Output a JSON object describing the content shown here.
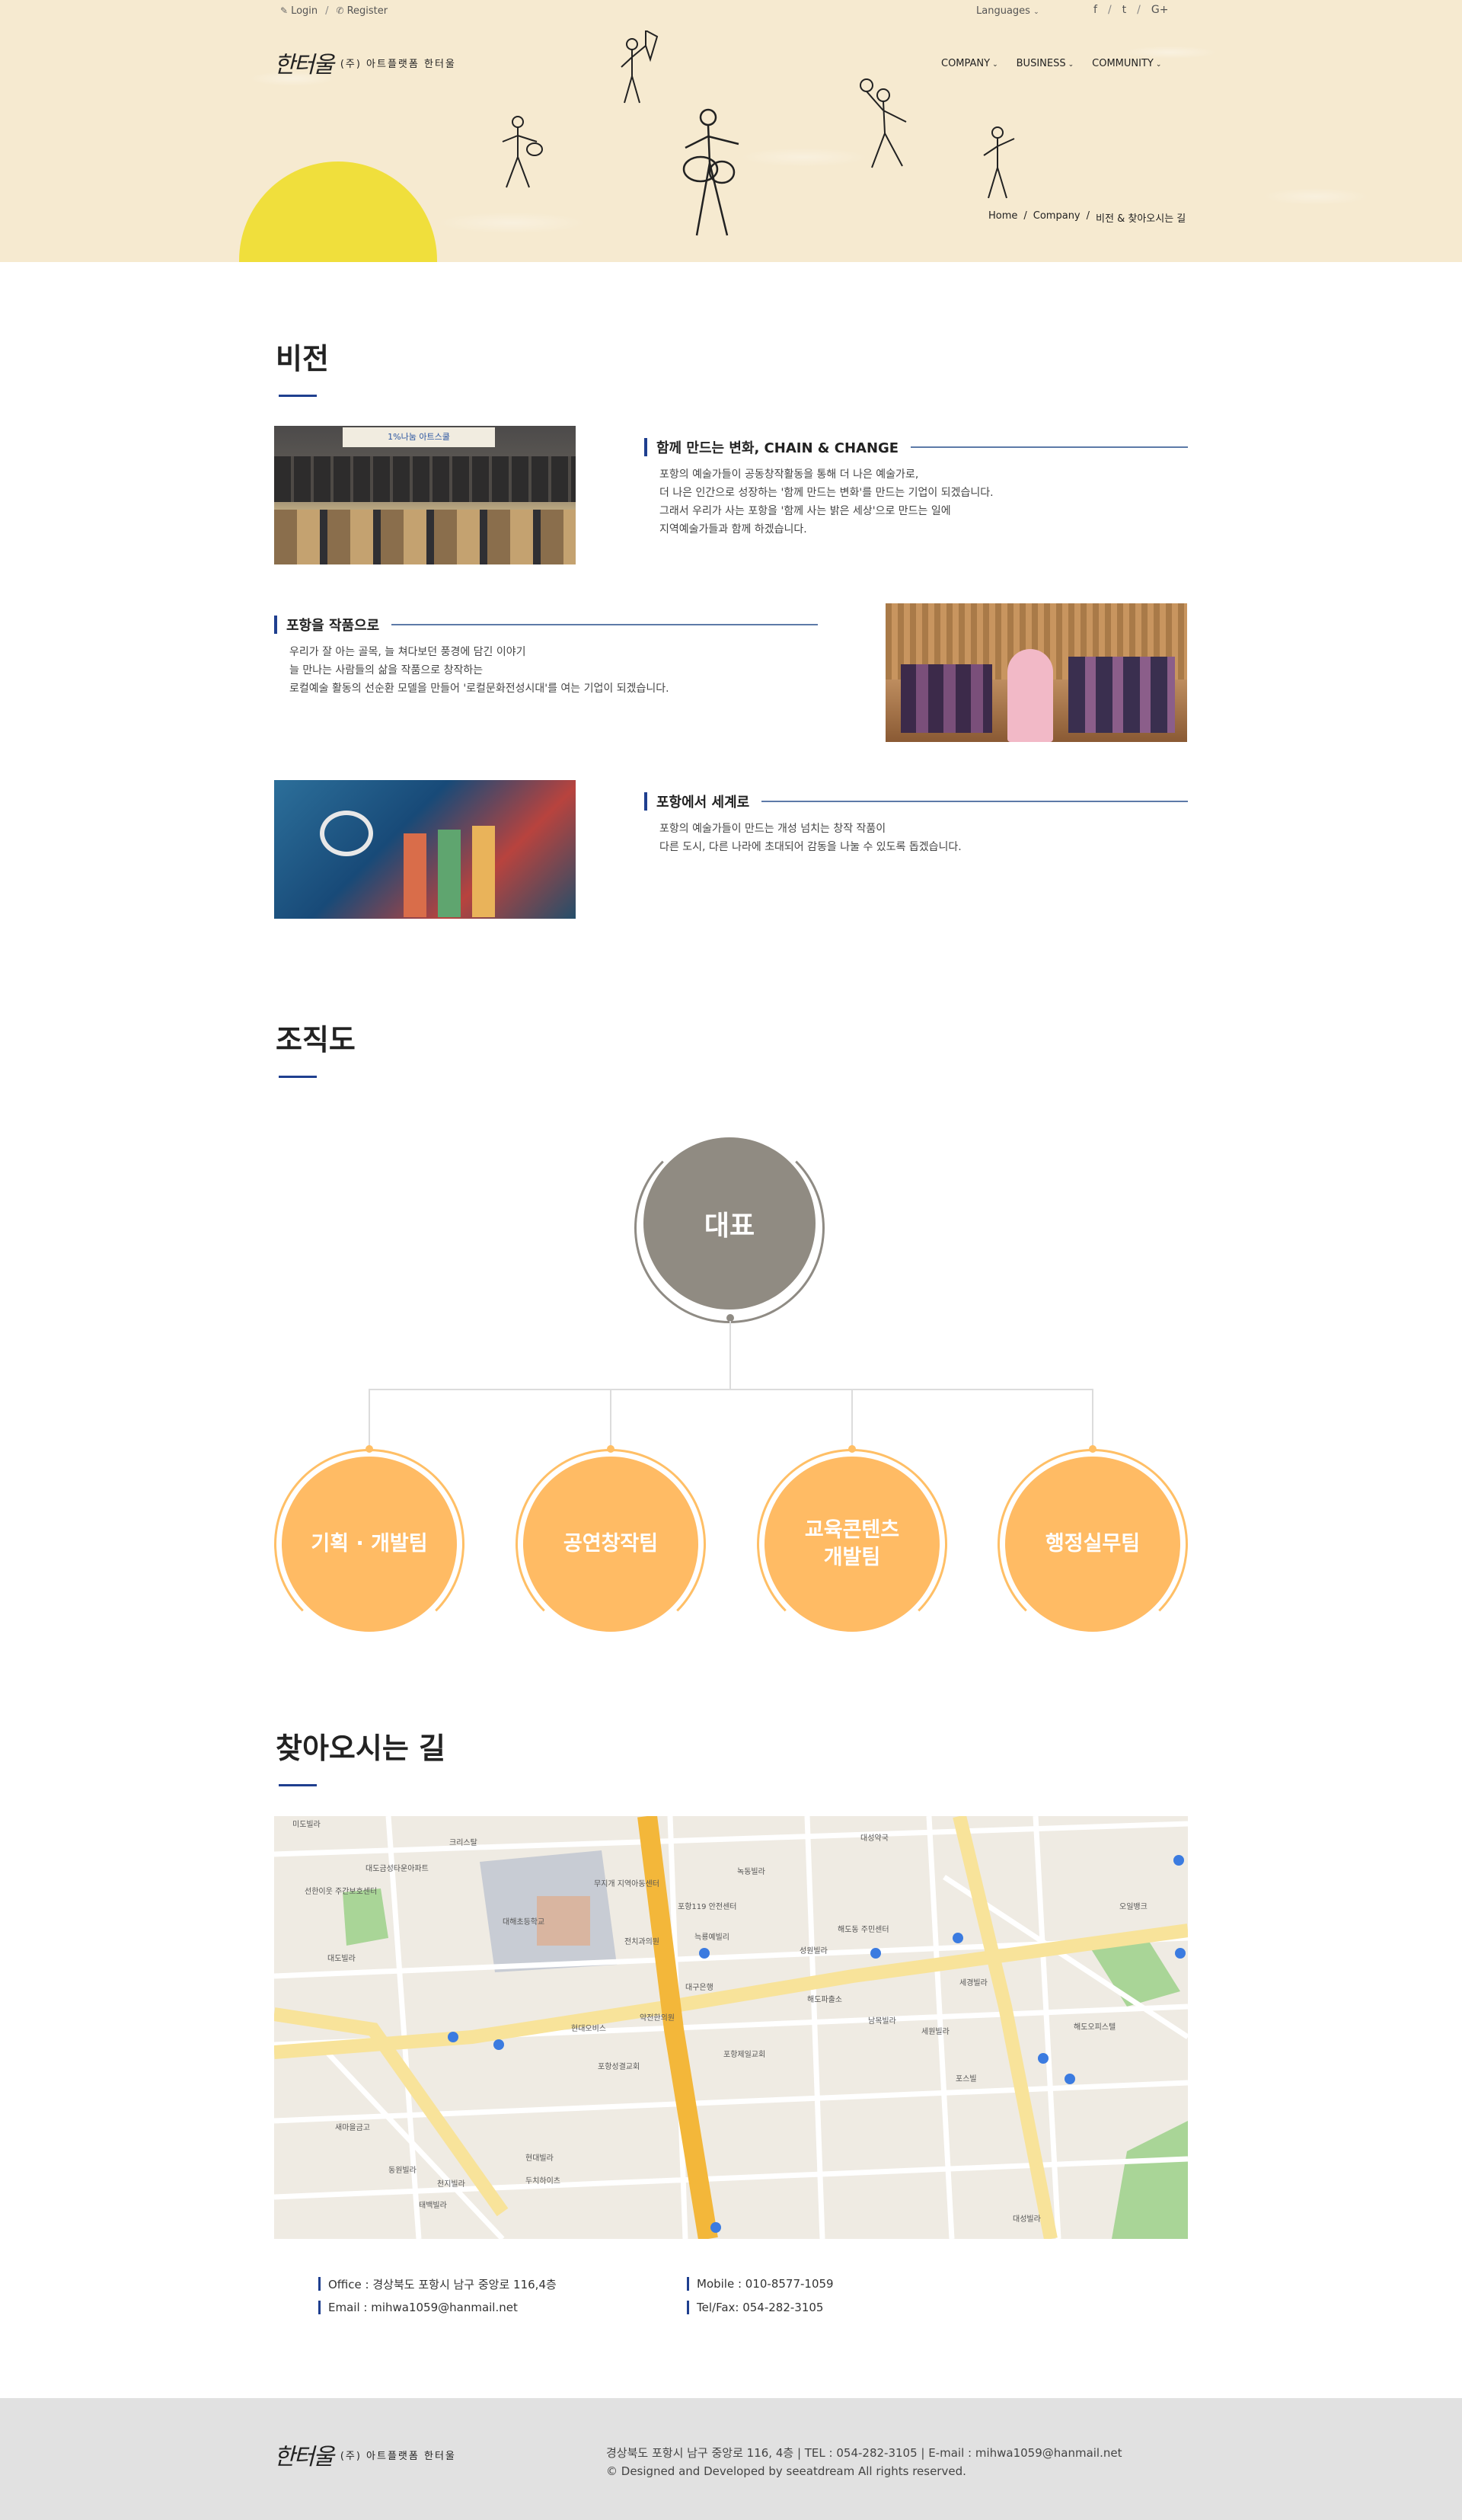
{
  "topbar": {
    "login": "Login",
    "register": "Register",
    "languages": "Languages",
    "social": [
      "f",
      "t",
      "G+"
    ]
  },
  "brand": {
    "logo_mark": "한터울",
    "logo_text": "(주) 아트플랫폼 한터울"
  },
  "nav": {
    "items": [
      "COMPANY",
      "BUSINESS",
      "COMMUNITY"
    ]
  },
  "breadcrumb": {
    "home": "Home",
    "company": "Company",
    "current": "비전 & 찾아오시는 길"
  },
  "vision": {
    "title": "비전",
    "items": [
      {
        "heading": "함께 만드는 변화, CHAIN & CHANGE",
        "lines": [
          "포항의 예술가들이 공동창작활동을 통해 더 나은 예술가로,",
          "더 나은 인간으로 성장하는 '함께 만드는 변화'를 만드는 기업이 되겠습니다.",
          "그래서 우리가 사는 포항을 '함께 사는 밝은 세상'으로 만드는 일에",
          "지역예술가들과 함께 하겠습니다."
        ]
      },
      {
        "heading": "포항을 작품으로",
        "lines": [
          "우리가 잘 아는 골목, 늘 쳐다보던 풍경에 담긴 이야기",
          "늘 만나는 사람들의 삶을 작품으로 창작하는",
          "로컬예술 활동의 선순환 모델을 만들어 '로컬문화전성시대'를 여는 기업이 되겠습니다."
        ]
      },
      {
        "heading": "포항에서 세계로",
        "lines": [
          "포항의 예술가들이 만드는 개성 넘치는 창작 작품이",
          "다른 도시, 다른 나라에 초대되어 감동을 나눌 수 있도록 돕겠습니다."
        ]
      }
    ],
    "photo1_banner": "1%나눔 아트스쿨"
  },
  "org": {
    "title": "조직도",
    "ceo": "대표",
    "teams": [
      "기획 · 개발팀",
      "공연창작팀",
      "교육콘텐츠\n개발팀",
      "행정실무팀"
    ]
  },
  "location": {
    "title": "찾아오시는 길",
    "map_labels": [
      "미도빌라",
      "크리스탈",
      "대도금성타운아파트",
      "선한이웃 주간보호센터",
      "대도빌라",
      "대해초등학교",
      "무지개 지역아동센터",
      "전치과의원",
      "포항119 안전센터",
      "늑룡예빌리",
      "해도동 주민센터",
      "성원빌라",
      "현대오비스",
      "약전한의원",
      "대구은행",
      "새마을금고",
      "해도파출소",
      "남목빌라",
      "포항성결교회",
      "동원빌라",
      "천지빌라",
      "태백빌라",
      "세경빌라",
      "대성약국",
      "현대빌라",
      "두치하이츠",
      "포항제일교회",
      "녹동빌라",
      "세원빌라",
      "포스빌",
      "대성빌라",
      "해도오피스텔",
      "오일뱅크"
    ],
    "contact": {
      "office": "Office : 경상북도 포항시 남구 중앙로 116,4층",
      "email": "Email : mihwa1059@hanmail.net",
      "mobile": "Mobile : 010-8577-1059",
      "telfax": "Tel/Fax: 054-282-3105"
    }
  },
  "footer": {
    "address_line": "경상북도 포항시 남구 중앙로 116, 4층  |  TEL : 054-282-3105  |  E-mail : mihwa1059@hanmail.net",
    "copyright": "© Designed and Developed by seeatdream  All rights reserved."
  }
}
